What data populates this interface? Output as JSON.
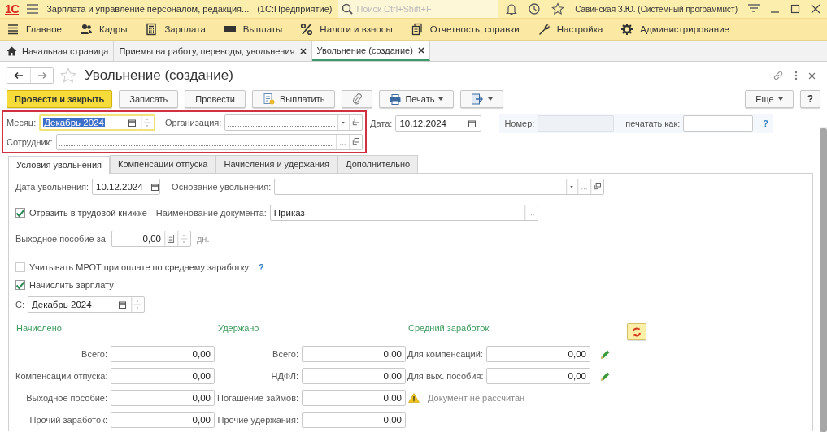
{
  "app": {
    "logo": "1С",
    "title": "Зарплата и управление персоналом, редакция...",
    "platform": "(1С:Предприятие)",
    "search": {
      "placeholder": "Поиск Ctrl+Shift+F"
    },
    "user": "Савинская З.Ю. (Системный программист)"
  },
  "sections": [
    {
      "label": "Главное",
      "kind": "main"
    },
    {
      "label": "Кадры",
      "kind": "staff"
    },
    {
      "label": "Зарплата",
      "kind": "salary"
    },
    {
      "label": "Выплаты",
      "kind": "payments"
    },
    {
      "label": "Налоги и взносы",
      "kind": "taxes"
    },
    {
      "label": "Отчетность, справки",
      "kind": "reports"
    },
    {
      "label": "Настройка",
      "kind": "setup"
    },
    {
      "label": "Администрирование",
      "kind": "admin"
    }
  ],
  "open_tabs": [
    {
      "label": "Начальная страница",
      "kind": "home",
      "selected": false
    },
    {
      "label": "Приемы на работу, переводы, увольнения",
      "kind": "closable",
      "selected": false
    },
    {
      "label": "Увольнение (создание)",
      "kind": "closable",
      "selected": true
    }
  ],
  "form": {
    "title": "Увольнение (создание)",
    "buttons": [
      {
        "label": "Провести и закрыть",
        "kind": "primary"
      },
      {
        "label": "Записать",
        "kind": "plain"
      },
      {
        "label": "Провести",
        "kind": "plain"
      },
      {
        "label": "Выплатить",
        "kind": "pay"
      },
      {
        "kind": "attach"
      },
      {
        "label": "Печать",
        "kind": "print"
      },
      {
        "kind": "export"
      }
    ],
    "right_buttons": [
      {
        "label": "Еще",
        "kind": "menu"
      },
      {
        "label": "?",
        "kind": "help"
      }
    ],
    "header": {
      "highlighted": true,
      "month": {
        "label": "Месяц:",
        "value": "Декабрь 2024",
        "focused": true
      },
      "organization": {
        "label": "Организация:"
      },
      "employee": {
        "label": "Сотрудник:"
      },
      "date": {
        "label": "Дата:",
        "value": "10.12.2024"
      },
      "number": {
        "label": "Номер:",
        "disabled": true
      },
      "print_as": {
        "label": "печатать как:"
      },
      "help": "?"
    },
    "tabs": [
      {
        "label": "Условия увольнения",
        "selected": true
      },
      {
        "label": "Компенсации отпуска",
        "selected": false
      },
      {
        "label": "Начисления и удержания",
        "selected": false
      },
      {
        "label": "Дополнительно",
        "selected": false
      }
    ],
    "conditions": {
      "dismissal_date": {
        "label": "Дата увольнения:",
        "value": "10.12.2024"
      },
      "reason": {
        "label": "Основание увольнения:"
      },
      "work_book": {
        "label": "Отразить в трудовой книжке",
        "checked": true
      },
      "document_name": {
        "label": "Наименование документа:",
        "value": "Приказ"
      },
      "severance": {
        "label": "Выходное пособие за:",
        "value": "0,00",
        "unit": "дн."
      },
      "mrot": {
        "label": "Учитывать МРОТ при оплате по среднему заработку",
        "checked": false,
        "help": "?"
      },
      "accrue_salary": {
        "label": "Начислить зарплату",
        "checked": true
      },
      "from": {
        "label": "С:",
        "value": "Декабрь 2024"
      },
      "columns": [
        {
          "heading": "Начислено",
          "kind": "totals",
          "rows": [
            {
              "label": "Всего:",
              "value": "0,00"
            },
            {
              "label": "Компенсации отпуска:",
              "value": "0,00"
            },
            {
              "label": "Выходное пособие:",
              "value": "0,00"
            },
            {
              "label": "Прочий заработок:",
              "value": "0,00"
            }
          ]
        },
        {
          "heading": "Удержано",
          "kind": "totals",
          "rows": [
            {
              "label": "Всего:",
              "value": "0,00"
            },
            {
              "label": "НДФЛ:",
              "value": "0,00"
            },
            {
              "label": "Погашение займов:",
              "value": "0,00"
            },
            {
              "label": "Прочие удержания:",
              "value": "0,00"
            }
          ]
        },
        {
          "heading": "Средний заработок",
          "kind": "average",
          "rows": [
            {
              "label": "Для компенсаций:",
              "value": "0,00"
            },
            {
              "label": "Для вых. пособия:",
              "value": "0,00"
            }
          ],
          "warning": "Документ не рассчитан"
        }
      ]
    }
  }
}
